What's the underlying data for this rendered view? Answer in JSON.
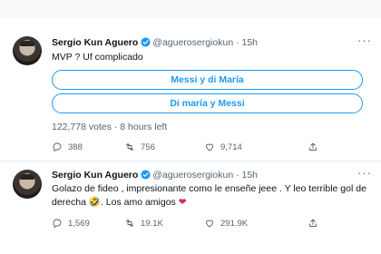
{
  "tweets": [
    {
      "name": "Sergio Kun Aguero",
      "handle": "@aguerosergiokun",
      "time": "· 15h",
      "text": "MVP ? Uf complicado",
      "poll": {
        "options": [
          "Messi y di María",
          "Di maría y Messi"
        ],
        "meta": "122,778 votes · 8 hours left"
      },
      "actions": {
        "replies": "388",
        "retweets": "756",
        "likes": "9,714"
      }
    },
    {
      "name": "Sergio Kun Aguero",
      "handle": "@aguerosergiokun",
      "time": "· 15h",
      "text_line1": "Golazo de fideo , impresionante como le enseñe jeee . Y leo terrible gol de",
      "text_line2": "derecha 🤣. Los amo amigos",
      "heart": "❤",
      "actions": {
        "replies": "1,569",
        "retweets": "19.1K",
        "likes": "291.9K"
      }
    }
  ],
  "colors": {
    "accent": "#1d9bf0",
    "secondary": "#536471",
    "heart": "#e0245e"
  }
}
